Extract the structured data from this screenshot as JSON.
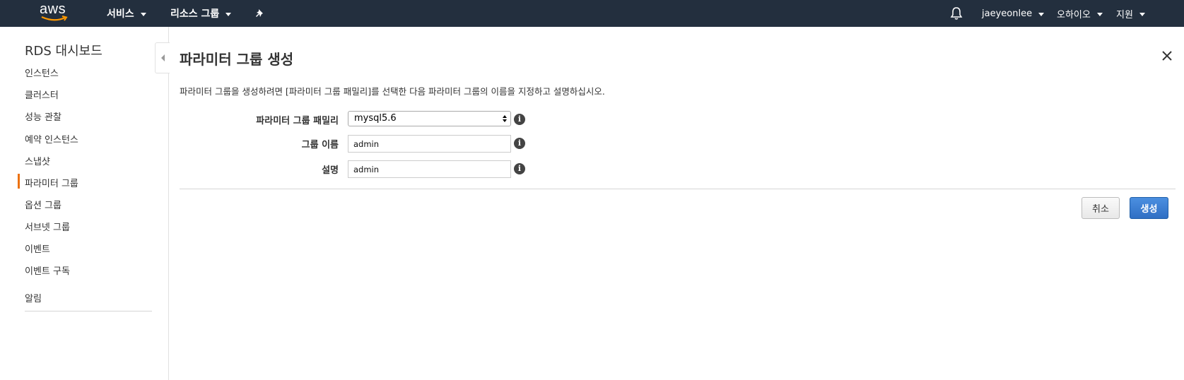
{
  "topbar": {
    "logo": "aws",
    "services": "서비스",
    "resource_groups": "리소스 그룹",
    "pin_icon": "pin-icon",
    "bell_icon": "bell-icon",
    "user": "jaeyeonlee",
    "region": "오하이오",
    "support": "지원"
  },
  "sidebar": {
    "title": "RDS 대시보드",
    "items": [
      {
        "label": "인스턴스"
      },
      {
        "label": "클러스터"
      },
      {
        "label": "성능 관찰"
      },
      {
        "label": "예약 인스턴스"
      },
      {
        "label": "스냅샷"
      },
      {
        "label": "파라미터 그룹",
        "active": true
      },
      {
        "label": "옵션 그룹"
      },
      {
        "label": "서브넷 그룹"
      },
      {
        "label": "이벤트"
      },
      {
        "label": "이벤트 구독"
      }
    ],
    "footer_item": "알림"
  },
  "main": {
    "title": "파라미터 그룹 생성",
    "description": "파라미터 그룹을 생성하려면 [파라미터 그룹 패밀리]를 선택한 다음 파라미터 그룹의 이름을 지정하고 설명하십시오.",
    "form": {
      "family_label": "파라미터 그룹 패밀리",
      "family_value": "mysql5.6",
      "name_label": "그룹 이름",
      "name_value": "admin",
      "desc_label": "설명",
      "desc_value": "admin"
    },
    "buttons": {
      "cancel": "취소",
      "create": "생성"
    }
  },
  "colors": {
    "topbar_bg": "#232f3e",
    "active_accent": "#ec7211",
    "primary_button": "#2f6fc4"
  }
}
